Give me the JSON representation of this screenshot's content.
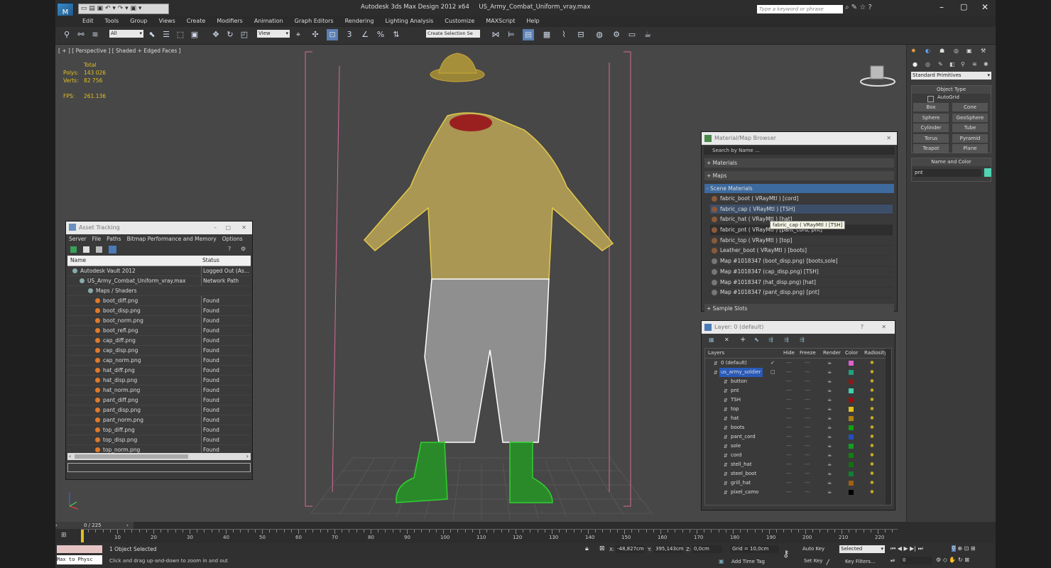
{
  "app": {
    "title": "Autodesk 3ds Max Design 2012 x64",
    "file": "US_Army_Combat_Uniform_vray.max",
    "search_placeholder": "Type a keyword or phrase"
  },
  "menu": [
    "Edit",
    "Tools",
    "Group",
    "Views",
    "Create",
    "Modifiers",
    "Animation",
    "Graph Editors",
    "Rendering",
    "Lighting Analysis",
    "Customize",
    "MAXScript",
    "Help"
  ],
  "toolbar": {
    "filter_value": "All",
    "refcoord_value": "View",
    "selection_set": "Create Selection Se"
  },
  "viewport": {
    "label": "[ + ] [ Perspective ] [ Shaded + Edged Faces ]",
    "stats_total_label": "Total",
    "polys_label": "Polys:",
    "polys_value": "143 026",
    "verts_label": "Verts:",
    "verts_value": "82 756",
    "fps_label": "FPS:",
    "fps_value": "261.136"
  },
  "command_panel": {
    "dropdown": "Standard Primitives",
    "object_type_title": "Object Type",
    "autogrid_label": "AutoGrid",
    "buttons": [
      "Box",
      "Cone",
      "Sphere",
      "GeoSphere",
      "Cylinder",
      "Tube",
      "Torus",
      "Pyramid",
      "Teapot",
      "Plane"
    ],
    "name_color_title": "Name and Color",
    "name_value": "pnt",
    "color": "#4fd5b3"
  },
  "asset_tracking": {
    "title": "Asset Tracking",
    "menu": [
      "Server",
      "File",
      "Paths",
      "Bitmap Performance and Memory",
      "Options"
    ],
    "col_name": "Name",
    "col_status": "Status",
    "rows": [
      {
        "name": "Autodesk Vault 2012",
        "status": "Logged Out (As..."
      },
      {
        "name": "US_Army_Combat_Uniform_vray.max",
        "status": "Network Path"
      },
      {
        "name": "Maps / Shaders",
        "status": ""
      },
      {
        "name": "boot_diff.png",
        "status": "Found"
      },
      {
        "name": "boot_disp.png",
        "status": "Found"
      },
      {
        "name": "boot_norm.png",
        "status": "Found"
      },
      {
        "name": "boot_refl.png",
        "status": "Found"
      },
      {
        "name": "cap_diff.png",
        "status": "Found"
      },
      {
        "name": "cap_disp.png",
        "status": "Found"
      },
      {
        "name": "cap_norm.png",
        "status": "Found"
      },
      {
        "name": "hat_diff.png",
        "status": "Found"
      },
      {
        "name": "hat_disp.png",
        "status": "Found"
      },
      {
        "name": "hat_norm.png",
        "status": "Found"
      },
      {
        "name": "pant_diff.png",
        "status": "Found"
      },
      {
        "name": "pant_disp.png",
        "status": "Found"
      },
      {
        "name": "pant_norm.png",
        "status": "Found"
      },
      {
        "name": "top_diff.png",
        "status": "Found"
      },
      {
        "name": "top_disp.png",
        "status": "Found"
      },
      {
        "name": "top_norm.png",
        "status": "Found"
      }
    ]
  },
  "material_browser": {
    "title": "Material/Map Browser",
    "search_placeholder": "Search by Name ...",
    "sections": [
      "+ Materials",
      "+ Maps",
      "- Scene Materials"
    ],
    "items": [
      "fabric_boot  ( VRayMtl ) [cord]",
      "fabric_cap  ( VRayMtl ) [TSH]",
      "fabric_hat  ( VRayMtl ) [hat]",
      "fabric_pnt  ( VRayMtl ) [pant_cord, pnt]",
      "fabric_top  ( VRayMtl ) [top]",
      "Leather_boot  ( VRayMtl ) [boots]",
      "Map #1018347 (boot_disp.png) [boots,sole]",
      "Map #1018347 (cap_disp.png) [TSH]",
      "Map #1018347 (hat_disp.png) [hat]",
      "Map #1018347 (pant_disp.png) [pnt]"
    ],
    "tooltip": "fabric_cap  ( VRayMtl ) [TSH]",
    "sample_slots": "+ Sample Slots"
  },
  "layer_manager": {
    "title": "Layer: 0 (default)",
    "help": "?",
    "cols": [
      "Layers",
      "Hide",
      "Freeze",
      "Render",
      "Color",
      "Radiosity"
    ],
    "layers": [
      {
        "name": "0 (default)",
        "color": "#e060d0"
      },
      {
        "name": "us_army_soldier",
        "color": "#20a080"
      },
      {
        "name": "button",
        "color": "#8a1a1a"
      },
      {
        "name": "pnt",
        "color": "#40d0b0"
      },
      {
        "name": "TSH",
        "color": "#9a1010"
      },
      {
        "name": "top",
        "color": "#e0c020"
      },
      {
        "name": "hat",
        "color": "#b08010"
      },
      {
        "name": "boots",
        "color": "#10a010"
      },
      {
        "name": "pant_cord",
        "color": "#2050c0"
      },
      {
        "name": "sole",
        "color": "#10a020"
      },
      {
        "name": "cord",
        "color": "#108010"
      },
      {
        "name": "stell_hat",
        "color": "#107010"
      },
      {
        "name": "steel_boot",
        "color": "#108030"
      },
      {
        "name": "grill_hat",
        "color": "#a06010"
      },
      {
        "name": "pixel_camo",
        "color": "#000000"
      }
    ]
  },
  "timeline": {
    "frame_label": "0 / 225",
    "ticks": [
      "10",
      "20",
      "30",
      "40",
      "50",
      "60",
      "70",
      "80",
      "90",
      "100",
      "110",
      "120",
      "130",
      "140",
      "150",
      "160",
      "170",
      "180",
      "190",
      "200",
      "210",
      "220"
    ]
  },
  "statusbar": {
    "maxscript": "Max to Physc",
    "selected": "1 Object Selected",
    "prompt": "Click and drag up-and-down to zoom in and out",
    "x_label": "X:",
    "x_value": "-48,827cm",
    "y_label": "Y:",
    "y_value": "395,143cm",
    "z_label": "Z:",
    "z_value": "0,0cm",
    "grid": "Grid = 10,0cm",
    "add_time_tag": "Add Time Tag",
    "auto_key": "Auto Key",
    "set_key": "Set Key",
    "selected_dd": "Selected",
    "key_filters": "Key Filters...",
    "frame_value": "0"
  }
}
